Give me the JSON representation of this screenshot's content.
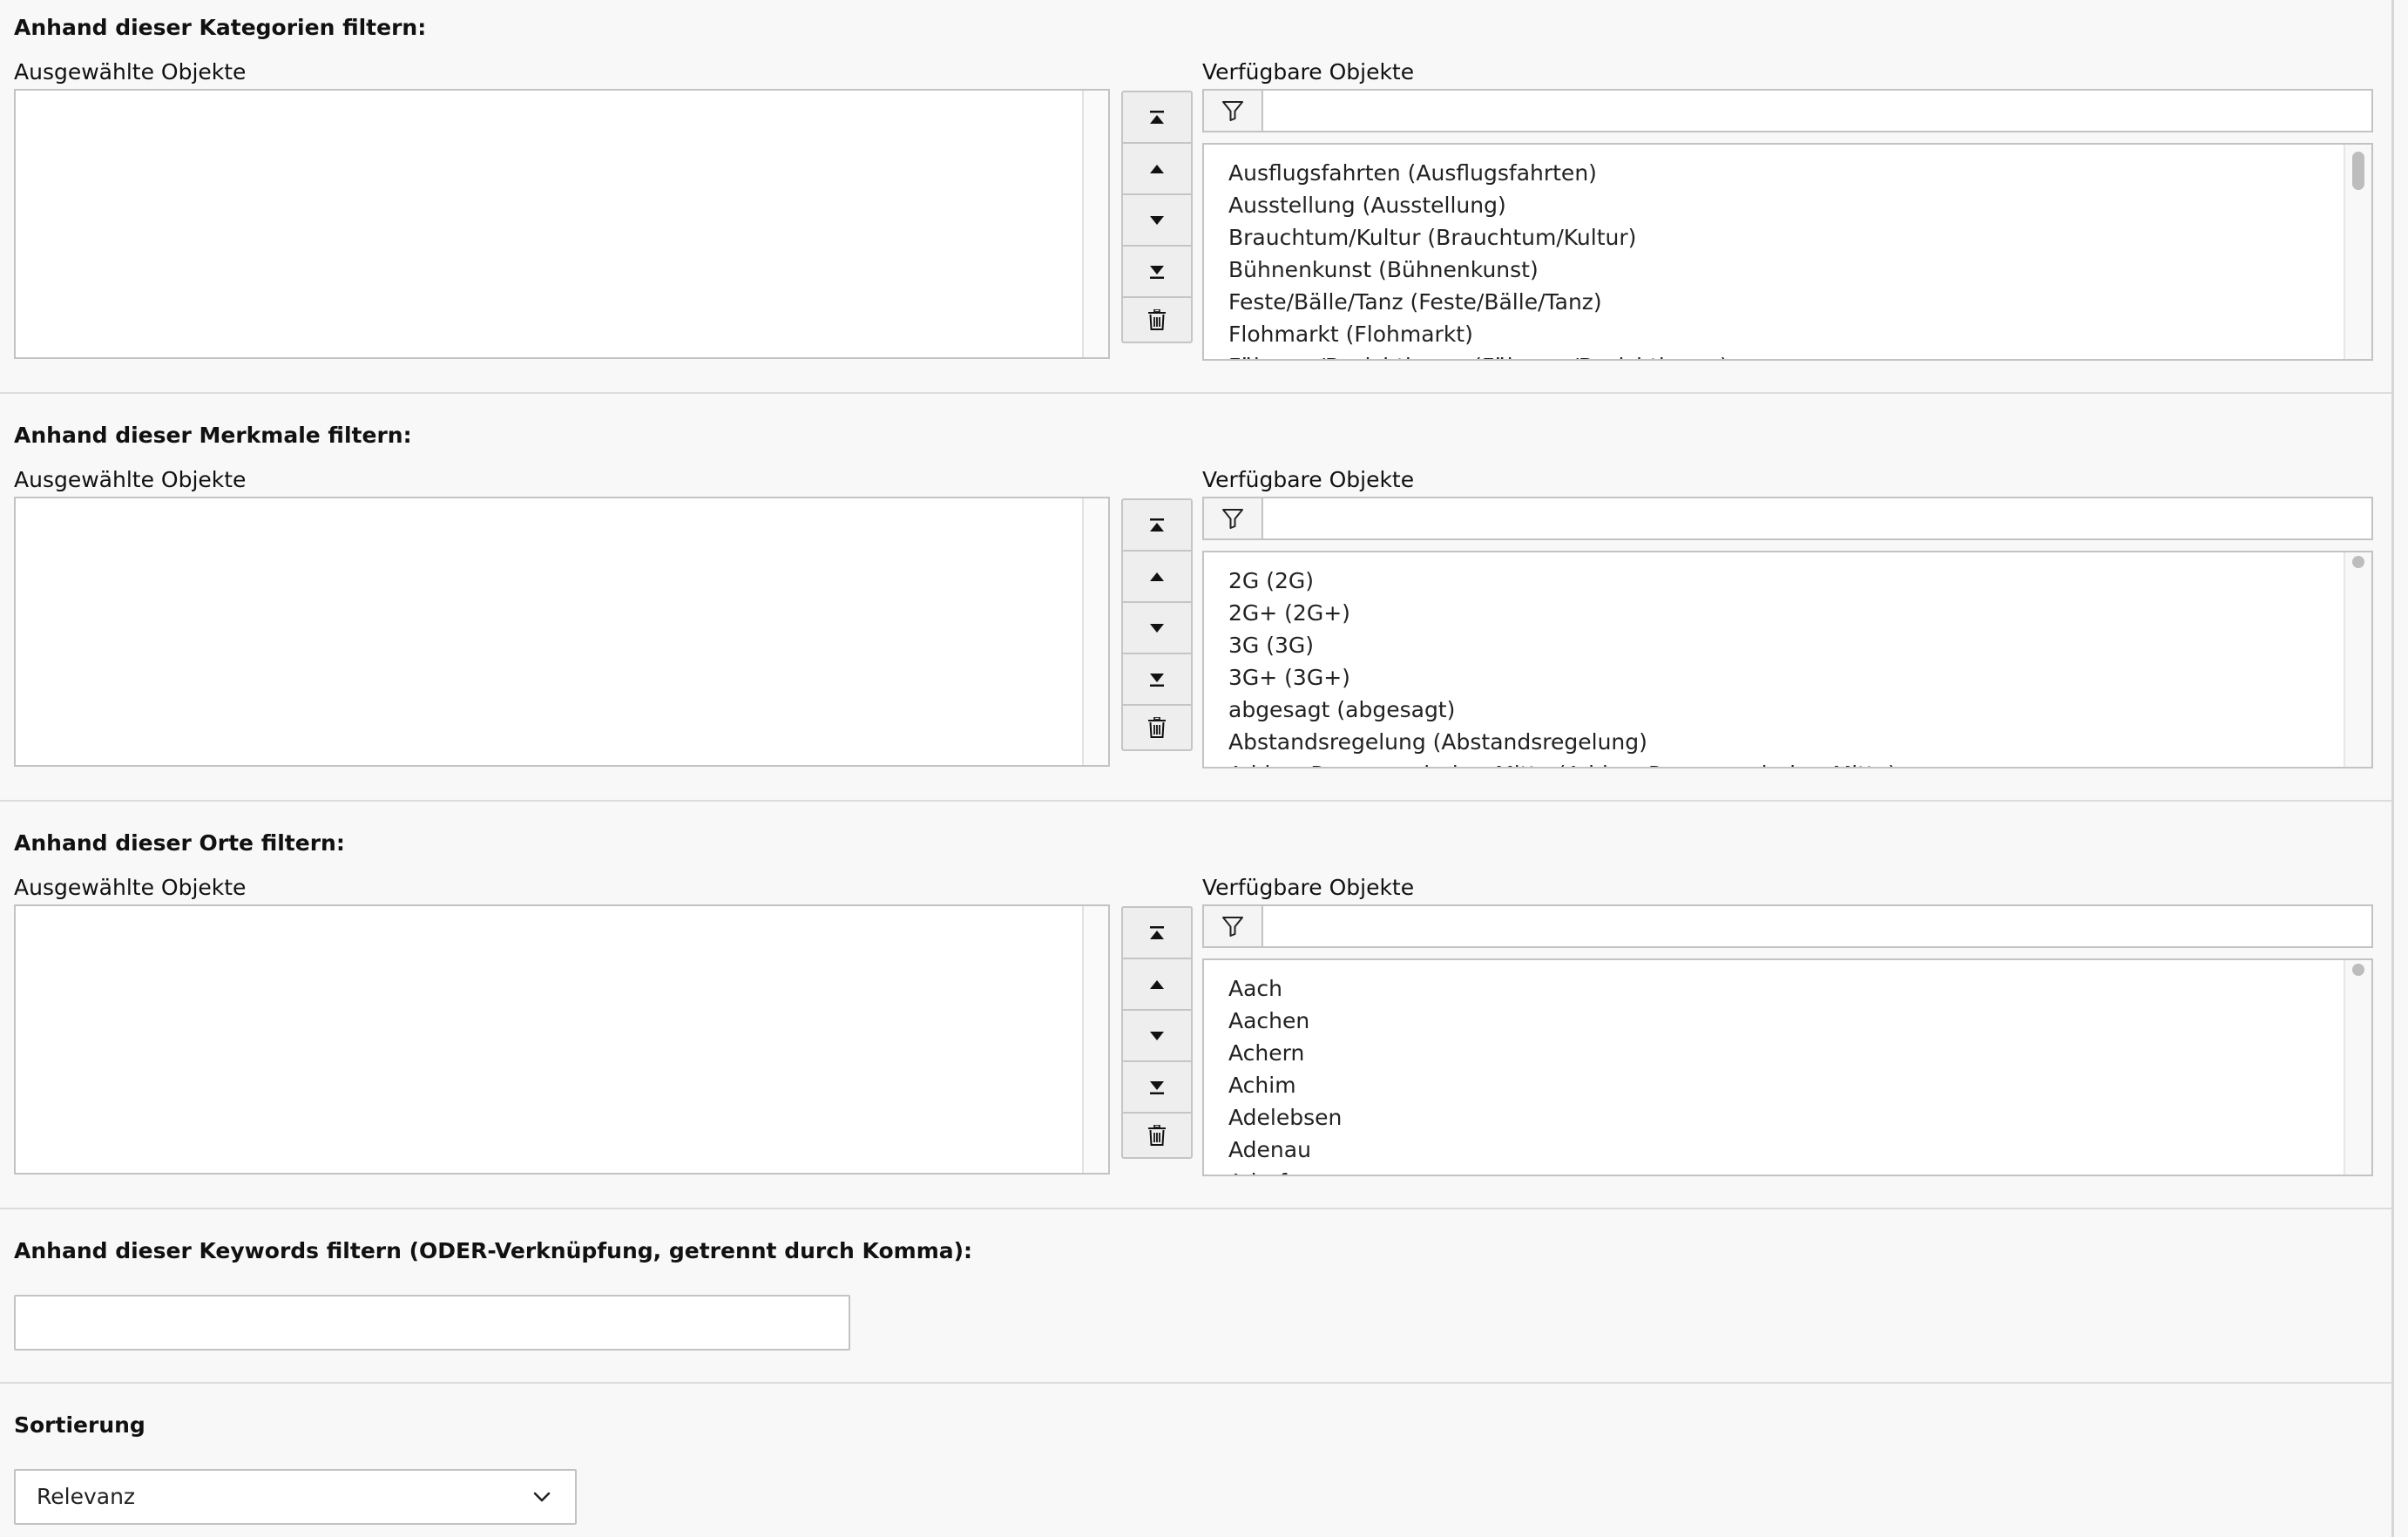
{
  "sections": [
    {
      "heading": "Anhand dieser Kategorien filtern:",
      "selected_label": "Ausgewählte Objekte",
      "available_label": "Verfügbare Objekte",
      "filter_placeholder": "",
      "items": [
        "Ausflugsfahrten (Ausflugsfahrten)",
        "Ausstellung (Ausstellung)",
        "Brauchtum/Kultur (Brauchtum/Kultur)",
        "Bühnenkunst (Bühnenkunst)",
        "Feste/Bälle/Tanz (Feste/Bälle/Tanz)",
        "Flohmarkt (Flohmarkt)",
        "Führung/Besichtigung (Führung/Besichtigung)"
      ]
    },
    {
      "heading": "Anhand dieser Merkmale filtern:",
      "selected_label": "Ausgewählte Objekte",
      "available_label": "Verfügbare Objekte",
      "filter_placeholder": "",
      "items": [
        "2G (2G)",
        "2G+ (2G+)",
        "3G (3G)",
        "3G+ (3G+)",
        "abgesagt (abgesagt)",
        "Abstandsregelung (Abstandsregelung)",
        "Ad-hoc Programmierbar Mitte (Ad-hoc Programmierbar Mitte)"
      ]
    },
    {
      "heading": "Anhand dieser Orte filtern:",
      "selected_label": "Ausgewählte Objekte",
      "available_label": "Verfügbare Objekte",
      "filter_placeholder": "",
      "items": [
        "Aach",
        "Aachen",
        "Achern",
        "Achim",
        "Adelebsen",
        "Adenau",
        "Adorf"
      ]
    }
  ],
  "move_buttons": {
    "icons": [
      "move-to-top-icon",
      "move-up-icon",
      "move-down-icon",
      "move-to-bottom-icon",
      "trash-icon"
    ]
  },
  "keywords": {
    "heading": "Anhand dieser Keywords filtern (ODER-Verknüpfung, getrennt durch Komma):",
    "value": ""
  },
  "sorting": {
    "heading": "Sortierung",
    "selected": "Relevanz",
    "icon": "chevron-down-icon"
  },
  "colors": {
    "background": "#f8f8f8",
    "border": "#c3c3c3",
    "button_bg": "#eeeeee",
    "text": "#111111"
  }
}
